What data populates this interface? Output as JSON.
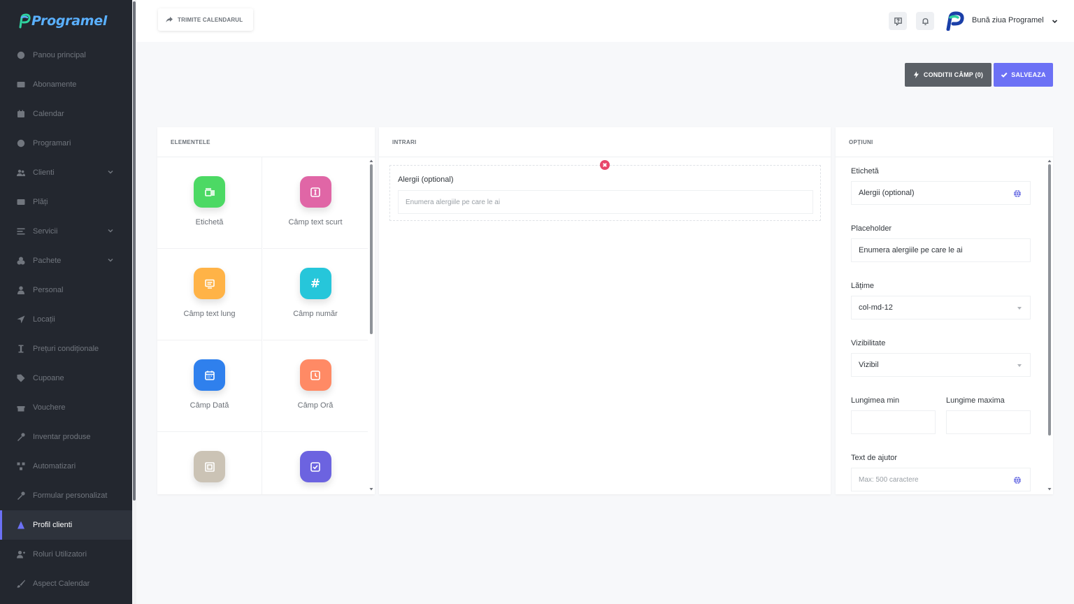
{
  "brand": {
    "name": "Programel",
    "color": "#5ab0ff"
  },
  "sidebar": {
    "items": [
      {
        "label": "Panou principal",
        "icon": "palette-icon",
        "chevron": false,
        "active": false
      },
      {
        "label": "Abonamente",
        "icon": "card-icon",
        "chevron": false,
        "active": false
      },
      {
        "label": "Calendar",
        "icon": "calendar-icon",
        "chevron": false,
        "active": false
      },
      {
        "label": "Programari",
        "icon": "clock-icon",
        "chevron": false,
        "active": false
      },
      {
        "label": "Clienti",
        "icon": "users-icon",
        "chevron": true,
        "active": false
      },
      {
        "label": "Plăți",
        "icon": "card-icon",
        "chevron": false,
        "active": false
      },
      {
        "label": "Servicii",
        "icon": "list-icon",
        "chevron": true,
        "active": false
      },
      {
        "label": "Pachete",
        "icon": "package-icon",
        "chevron": true,
        "active": false
      },
      {
        "label": "Personal",
        "icon": "person-icon",
        "chevron": false,
        "active": false
      },
      {
        "label": "Locații",
        "icon": "location-icon",
        "chevron": false,
        "active": false
      },
      {
        "label": "Prețuri condiționale",
        "icon": "price-icon",
        "chevron": false,
        "active": false
      },
      {
        "label": "Cupoane",
        "icon": "tag-icon",
        "chevron": false,
        "active": false
      },
      {
        "label": "Vouchere",
        "icon": "gift-icon",
        "chevron": false,
        "active": false
      },
      {
        "label": "Inventar produse",
        "icon": "tools-icon",
        "chevron": false,
        "active": false
      },
      {
        "label": "Automatizari",
        "icon": "flow-icon",
        "chevron": false,
        "active": false
      },
      {
        "label": "Formular personalizat",
        "icon": "tools-icon",
        "chevron": false,
        "active": false
      },
      {
        "label": "Profil clienti",
        "icon": "profile-icon",
        "chevron": false,
        "active": true
      },
      {
        "label": "Roluri Utilizatori",
        "icon": "user-plus-icon",
        "chevron": false,
        "active": false
      },
      {
        "label": "Aspect Calendar",
        "icon": "brush-icon",
        "chevron": false,
        "active": false
      }
    ]
  },
  "topbar": {
    "share_label": "TRIMITE CALENDARUL",
    "greeting": "Bună ziua Programel"
  },
  "actions": {
    "conditions_label": "CONDITII CÂMP (0)",
    "save_label": "SALVEAZA",
    "save_color": "#6c71f5"
  },
  "elements_panel": {
    "title": "ELEMENTELE",
    "items": [
      {
        "label": "Etichetă",
        "color": "#4cd964",
        "icon": "label-icon"
      },
      {
        "label": "Câmp text scurt",
        "color": "#e066a6",
        "icon": "text-short-icon"
      },
      {
        "label": "Câmp text lung",
        "color": "#ffb347",
        "icon": "text-long-icon"
      },
      {
        "label": "Câmp număr",
        "color": "#26c6da",
        "icon": "hash-icon"
      },
      {
        "label": "Câmp Dată",
        "color": "#2f80ed",
        "icon": "date-icon"
      },
      {
        "label": "Câmp Oră",
        "color": "#ff8a65",
        "icon": "time-icon"
      },
      {
        "label": "",
        "color": "#cbc3b5",
        "icon": "frame-icon"
      },
      {
        "label": "",
        "color": "#6c63e0",
        "icon": "checkbox-icon"
      }
    ]
  },
  "inputs_panel": {
    "title": "INTRARI",
    "field": {
      "label": "Alergii (optional)",
      "placeholder": "Enumera alergiile pe care le ai"
    }
  },
  "options_panel": {
    "title": "OPȚIUNI",
    "label_caption": "Etichetă",
    "label_value": "Alergii (optional)",
    "placeholder_caption": "Placeholder",
    "placeholder_value": "Enumera alergiile pe care le ai",
    "width_caption": "Lățime",
    "width_value": "col-md-12",
    "visibility_caption": "Vizibilitate",
    "visibility_value": "Vizibil",
    "min_caption": "Lungimea min",
    "max_caption": "Lungime maxima",
    "help_caption": "Text de ajutor",
    "help_placeholder": "Max: 500 caractere"
  }
}
